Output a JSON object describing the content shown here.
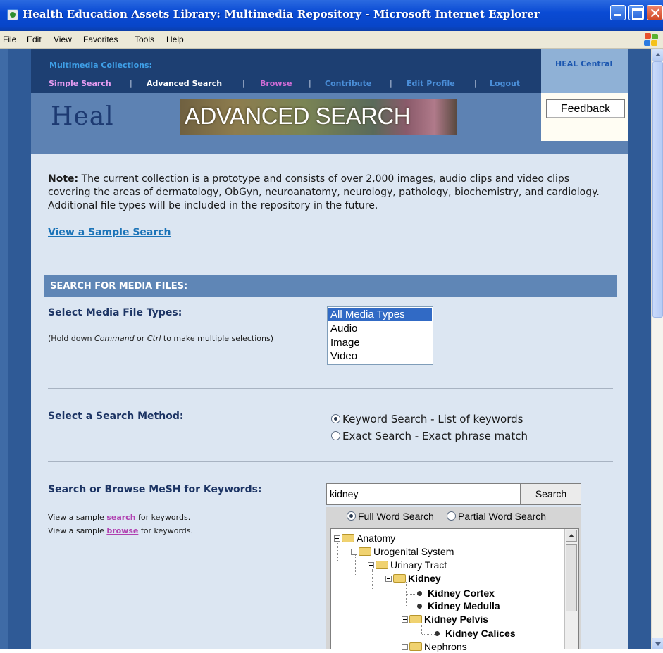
{
  "window": {
    "title": "Health Education Assets Library: Multimedia Repository - Microsoft Internet Explorer"
  },
  "menu": [
    "File",
    "Edit",
    "View",
    "Favorites",
    "Tools",
    "Help"
  ],
  "header": {
    "collections_label": "Multimedia Collections:",
    "nav": [
      {
        "label": "Simple Search",
        "color": "#e49bf0"
      },
      {
        "label": "Advanced Search",
        "color": "#ffffff"
      },
      {
        "label": "Browse",
        "color": "#d06cd6"
      },
      {
        "label": "Contribute",
        "color": "#4a8ed8"
      },
      {
        "label": "Edit Profile",
        "color": "#4a8ed8"
      },
      {
        "label": "Logout",
        "color": "#4a8ed8"
      }
    ],
    "separator": "|",
    "central_link": "HEAL Central",
    "feedback_label": "Feedback",
    "logo_text": "Heal",
    "banner_text": "ADVANCED SEARCH"
  },
  "note": {
    "lead": "Note:",
    "text": "The current collection is a prototype and consists of over 2,000 images, audio clips and video clips covering the areas of dermatology, ObGyn, neuroanatomy, neurology, pathology, biochemistry, and cardiology. Additional file types will be included in the repository in the future.",
    "sample_link": "View a Sample Search"
  },
  "section": {
    "title": "SEARCH FOR MEDIA FILES:"
  },
  "media_types": {
    "label": "Select Media File Types:",
    "hint_pre": "(Hold down ",
    "hint_cmd": "Command",
    "hint_or": " or ",
    "hint_ctrl": "Ctrl",
    "hint_post": " to make multiple selections)",
    "options": [
      "All Media Types",
      "Audio",
      "Image",
      "Video"
    ],
    "selected": "All Media Types"
  },
  "search_method": {
    "label": "Select a Search Method:",
    "options": [
      {
        "label": "Keyword Search - List of keywords",
        "checked": true
      },
      {
        "label": "Exact Search - Exact phrase match",
        "checked": false
      }
    ]
  },
  "mesh": {
    "label": "Search or Browse MeSH for Keywords:",
    "hint1_pre": "View a sample ",
    "hint1_link": "search",
    "hint1_post": " for keywords.",
    "hint2_pre": "View a sample ",
    "hint2_link": "browse",
    "hint2_post": " for keywords.",
    "input_value": "kidney",
    "search_button": "Search",
    "full_word": "Full Word Search",
    "partial_word": "Partial Word Search",
    "tree": [
      {
        "label": "Anatomy",
        "kind": "folder",
        "bold": false
      },
      {
        "label": "Urogenital System",
        "kind": "folder",
        "bold": false
      },
      {
        "label": "Urinary Tract",
        "kind": "folder",
        "bold": false
      },
      {
        "label": "Kidney",
        "kind": "folder",
        "bold": true
      },
      {
        "label": "Kidney Cortex",
        "kind": "leaf",
        "bold": true
      },
      {
        "label": "Kidney Medulla",
        "kind": "leaf",
        "bold": true
      },
      {
        "label": "Kidney Pelvis",
        "kind": "folder",
        "bold": true
      },
      {
        "label": "Kidney Calices",
        "kind": "leaf",
        "bold": true
      },
      {
        "label": "Nephrons",
        "kind": "folder",
        "bold": false
      }
    ]
  }
}
